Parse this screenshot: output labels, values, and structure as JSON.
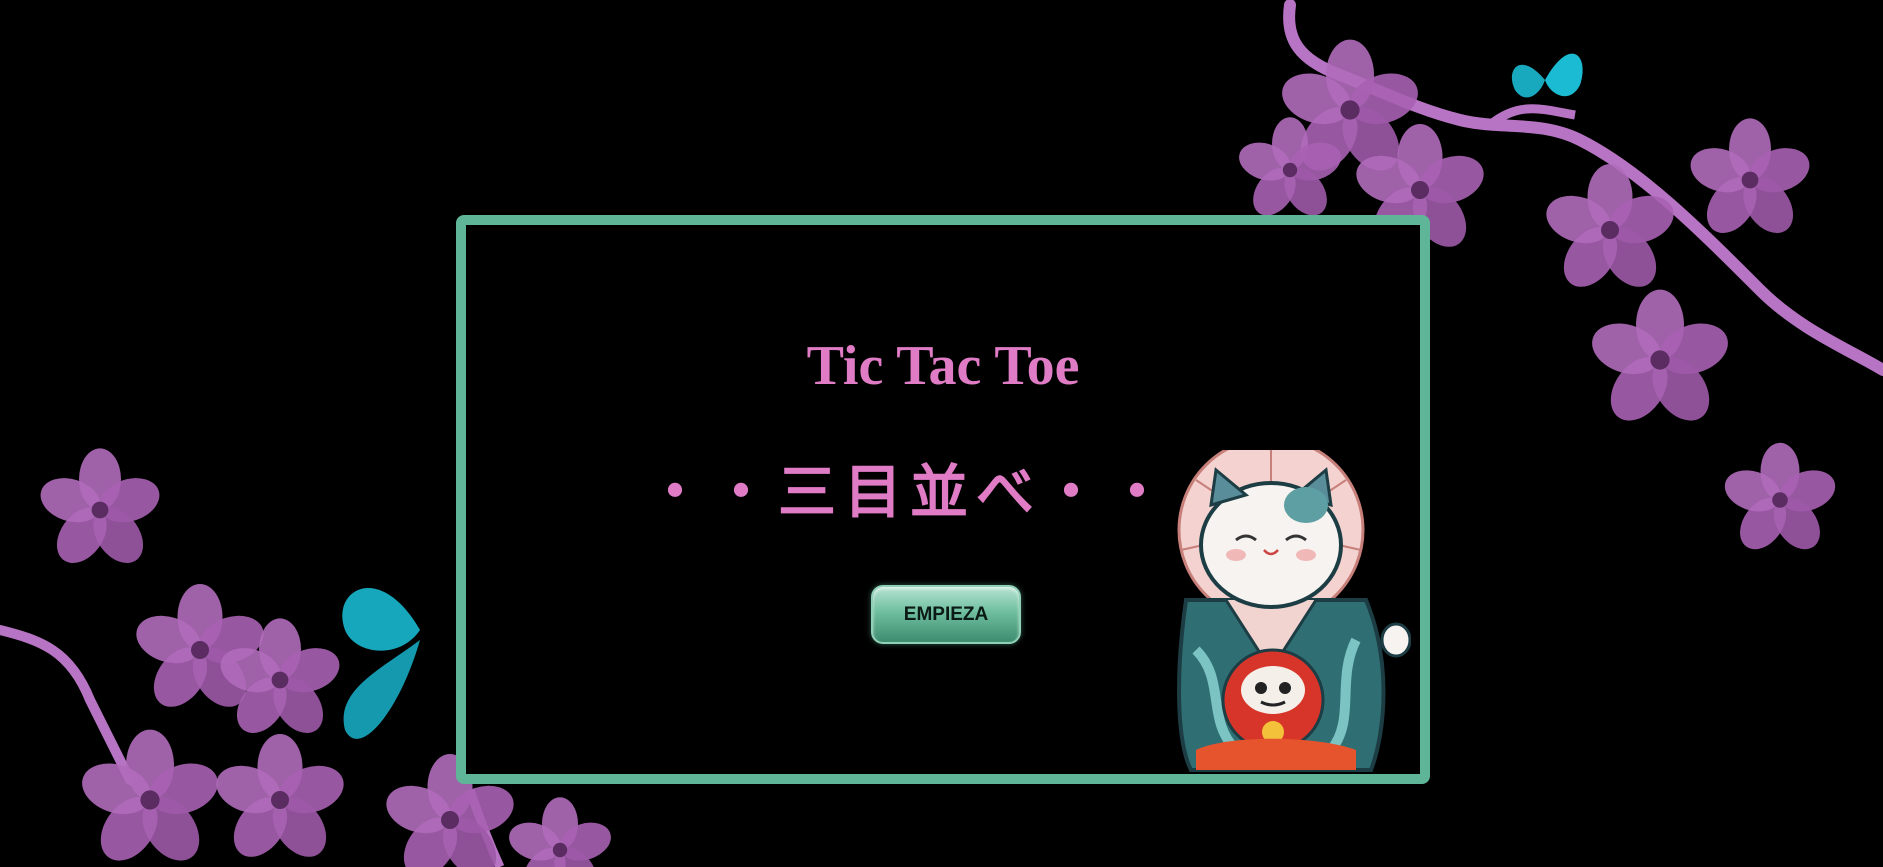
{
  "game": {
    "title": "Tic Tac Toe",
    "subtitle": "・・三目並べ・・・",
    "start_button_label": "EMPIEZA"
  },
  "colors": {
    "background": "#000000",
    "panel_border": "#5fb597",
    "title_text": "#e07cc6",
    "blossom": "#b76fc0",
    "butterfly": "#19b3c7"
  },
  "decorations": {
    "background_icons": [
      "cherry-blossom-branch-icon",
      "butterfly-icon"
    ],
    "mascot_icon": "maneki-neko-kimono-daruma-icon"
  }
}
